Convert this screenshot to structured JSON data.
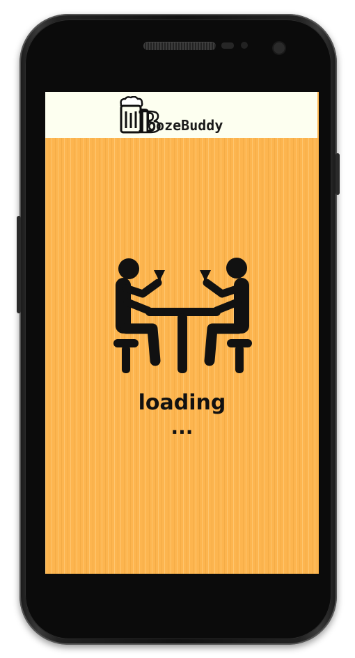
{
  "app": {
    "brand_initial": "B",
    "brand_rest": "oozeBuddy"
  },
  "splash": {
    "status_text": "loading",
    "ellipsis": "..."
  },
  "icons": {
    "logo": "beer-mug-icon",
    "illustration": "people-drinking-at-bar-table-icon"
  },
  "colors": {
    "background": "#fdb54f",
    "header": "#fdfff0",
    "ink": "#111111"
  }
}
